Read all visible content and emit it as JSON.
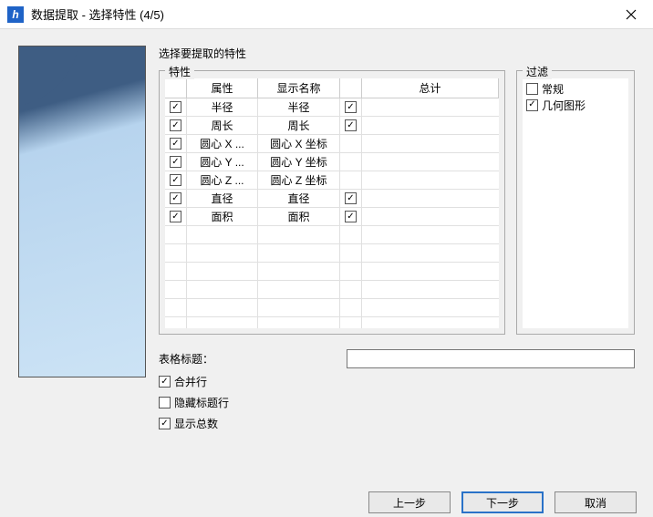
{
  "titlebar": {
    "icon_letter": "h",
    "title": "数据提取 - 选择特性 (4/5)"
  },
  "instruction": "选择要提取的特性",
  "properties": {
    "legend": "特性",
    "headers": {
      "attr": "属性",
      "display": "显示名称",
      "sum": "总计"
    },
    "rows": [
      {
        "attr": "半径",
        "display": "半径",
        "attr_checked": true,
        "sum_checked": true
      },
      {
        "attr": "周长",
        "display": "周长",
        "attr_checked": true,
        "sum_checked": true
      },
      {
        "attr": "圆心 X ...",
        "display": "圆心 X 坐标",
        "attr_checked": true,
        "sum_checked": null
      },
      {
        "attr": "圆心 Y ...",
        "display": "圆心 Y 坐标",
        "attr_checked": true,
        "sum_checked": null
      },
      {
        "attr": "圆心 Z ...",
        "display": "圆心 Z 坐标",
        "attr_checked": true,
        "sum_checked": null
      },
      {
        "attr": "直径",
        "display": "直径",
        "attr_checked": true,
        "sum_checked": true
      },
      {
        "attr": "面积",
        "display": "面积",
        "attr_checked": true,
        "sum_checked": true
      }
    ]
  },
  "filter": {
    "legend": "过滤",
    "items": [
      {
        "label": "常规",
        "checked": false
      },
      {
        "label": "几何图形",
        "checked": true
      }
    ]
  },
  "table_title": {
    "label": "表格标题：",
    "value": ""
  },
  "options": {
    "merge_rows": {
      "label": "合并行",
      "checked": true
    },
    "hide_header": {
      "label": "隐藏标题行",
      "checked": false
    },
    "show_totals": {
      "label": "显示总数",
      "checked": true
    }
  },
  "buttons": {
    "back": "上一步",
    "next": "下一步",
    "cancel": "取消"
  }
}
